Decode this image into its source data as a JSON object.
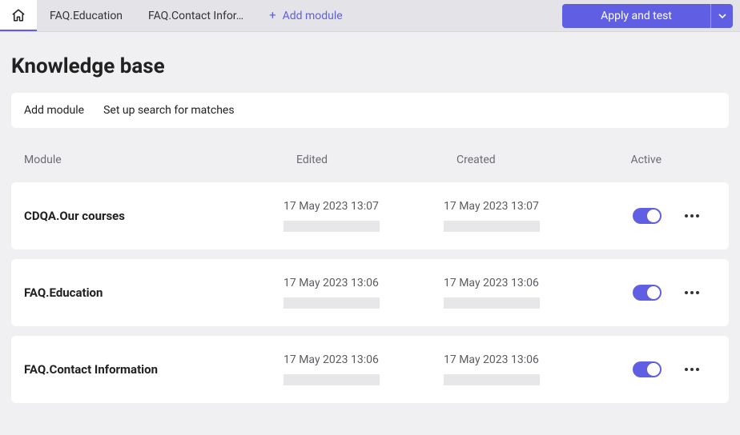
{
  "topbar": {
    "tabs": [
      {
        "label": "FAQ.Education"
      },
      {
        "label": "FAQ.Contact Infor…"
      }
    ],
    "add_module_label": "Add module",
    "apply_label": "Apply and test"
  },
  "page": {
    "title": "Knowledge base"
  },
  "subbar": {
    "add_module": "Add module",
    "setup_search": "Set up search for matches"
  },
  "table": {
    "headers": {
      "module": "Module",
      "edited": "Edited",
      "created": "Created",
      "active": "Active"
    },
    "rows": [
      {
        "name": "CDQA.Our courses",
        "edited": "17 May 2023 13:07",
        "created": "17 May 2023 13:07",
        "active": true
      },
      {
        "name": "FAQ.Education",
        "edited": "17 May 2023 13:06",
        "created": "17 May 2023 13:06",
        "active": true
      },
      {
        "name": "FAQ.Contact Information",
        "edited": "17 May 2023 13:06",
        "created": "17 May 2023 13:06",
        "active": true
      }
    ]
  }
}
